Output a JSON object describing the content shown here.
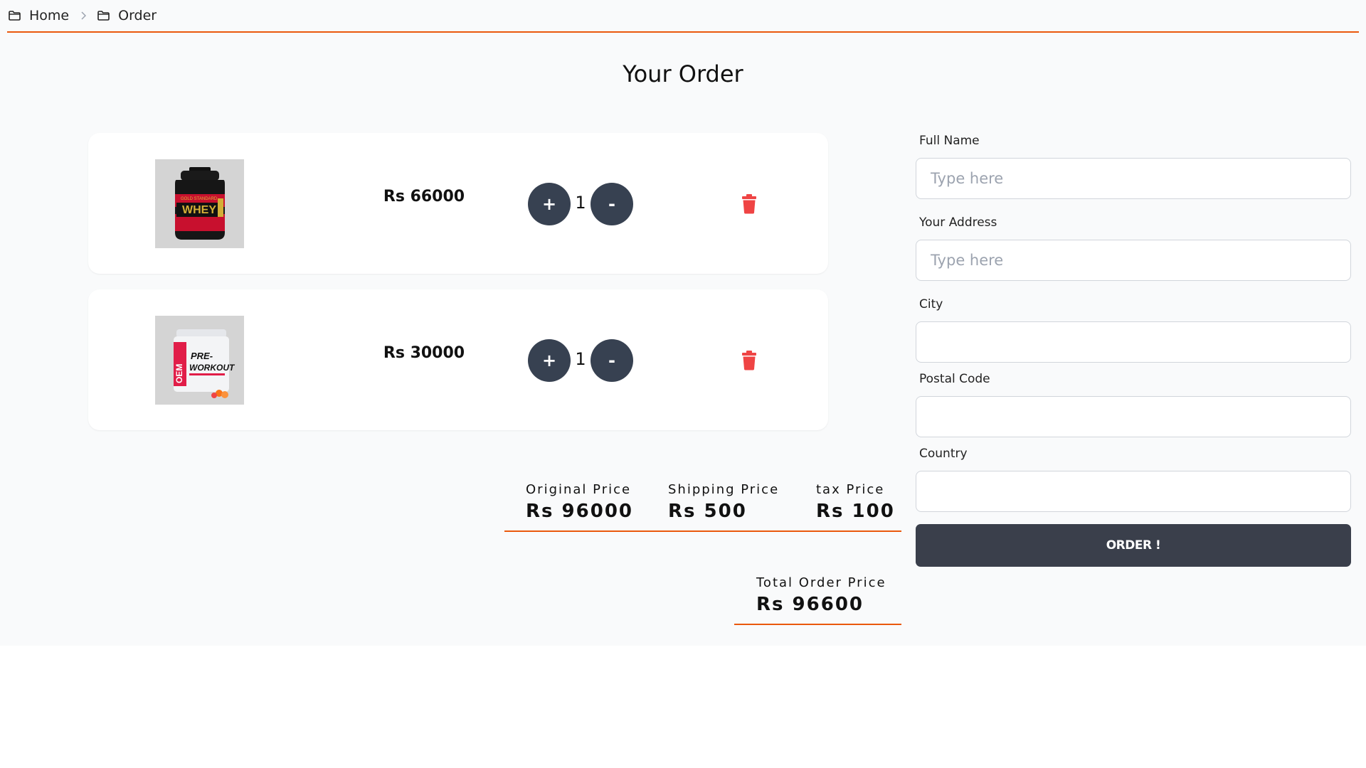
{
  "breadcrumb": {
    "items": [
      {
        "label": "Home",
        "icon": "folder-icon"
      },
      {
        "label": "Order",
        "icon": "folder-icon"
      }
    ],
    "separator_icon": "chevron-right-icon"
  },
  "page": {
    "title": "Your Order"
  },
  "cart": {
    "items": [
      {
        "product_image": "gold standard whey tub",
        "price": "Rs 66000",
        "quantity": "1",
        "plus_label": "+",
        "minus_label": "-"
      },
      {
        "product_image": "pre-workout tub",
        "price": "Rs 30000",
        "quantity": "1",
        "plus_label": "+",
        "minus_label": "-"
      }
    ]
  },
  "summary": {
    "original": {
      "label": "Original Price",
      "value": "Rs 96000"
    },
    "shipping": {
      "label": "Shipping Price",
      "value": "Rs 500"
    },
    "tax": {
      "label": "tax Price",
      "value": "Rs 100"
    },
    "total": {
      "label": "Total Order Price",
      "value": "Rs 96600"
    }
  },
  "form": {
    "full_name": {
      "label": "Full Name",
      "placeholder": "Type here",
      "value": ""
    },
    "address": {
      "label": "Your Address",
      "placeholder": "Type here",
      "value": ""
    },
    "city": {
      "label": "City",
      "value": ""
    },
    "postal_code": {
      "label": "Postal Code",
      "value": ""
    },
    "country": {
      "label": "Country",
      "value": ""
    },
    "order_button": "ORDER !"
  },
  "colors": {
    "accent": "#ea580c",
    "dark_button": "#374151",
    "delete": "#ef4444",
    "background": "#f9fafb"
  }
}
